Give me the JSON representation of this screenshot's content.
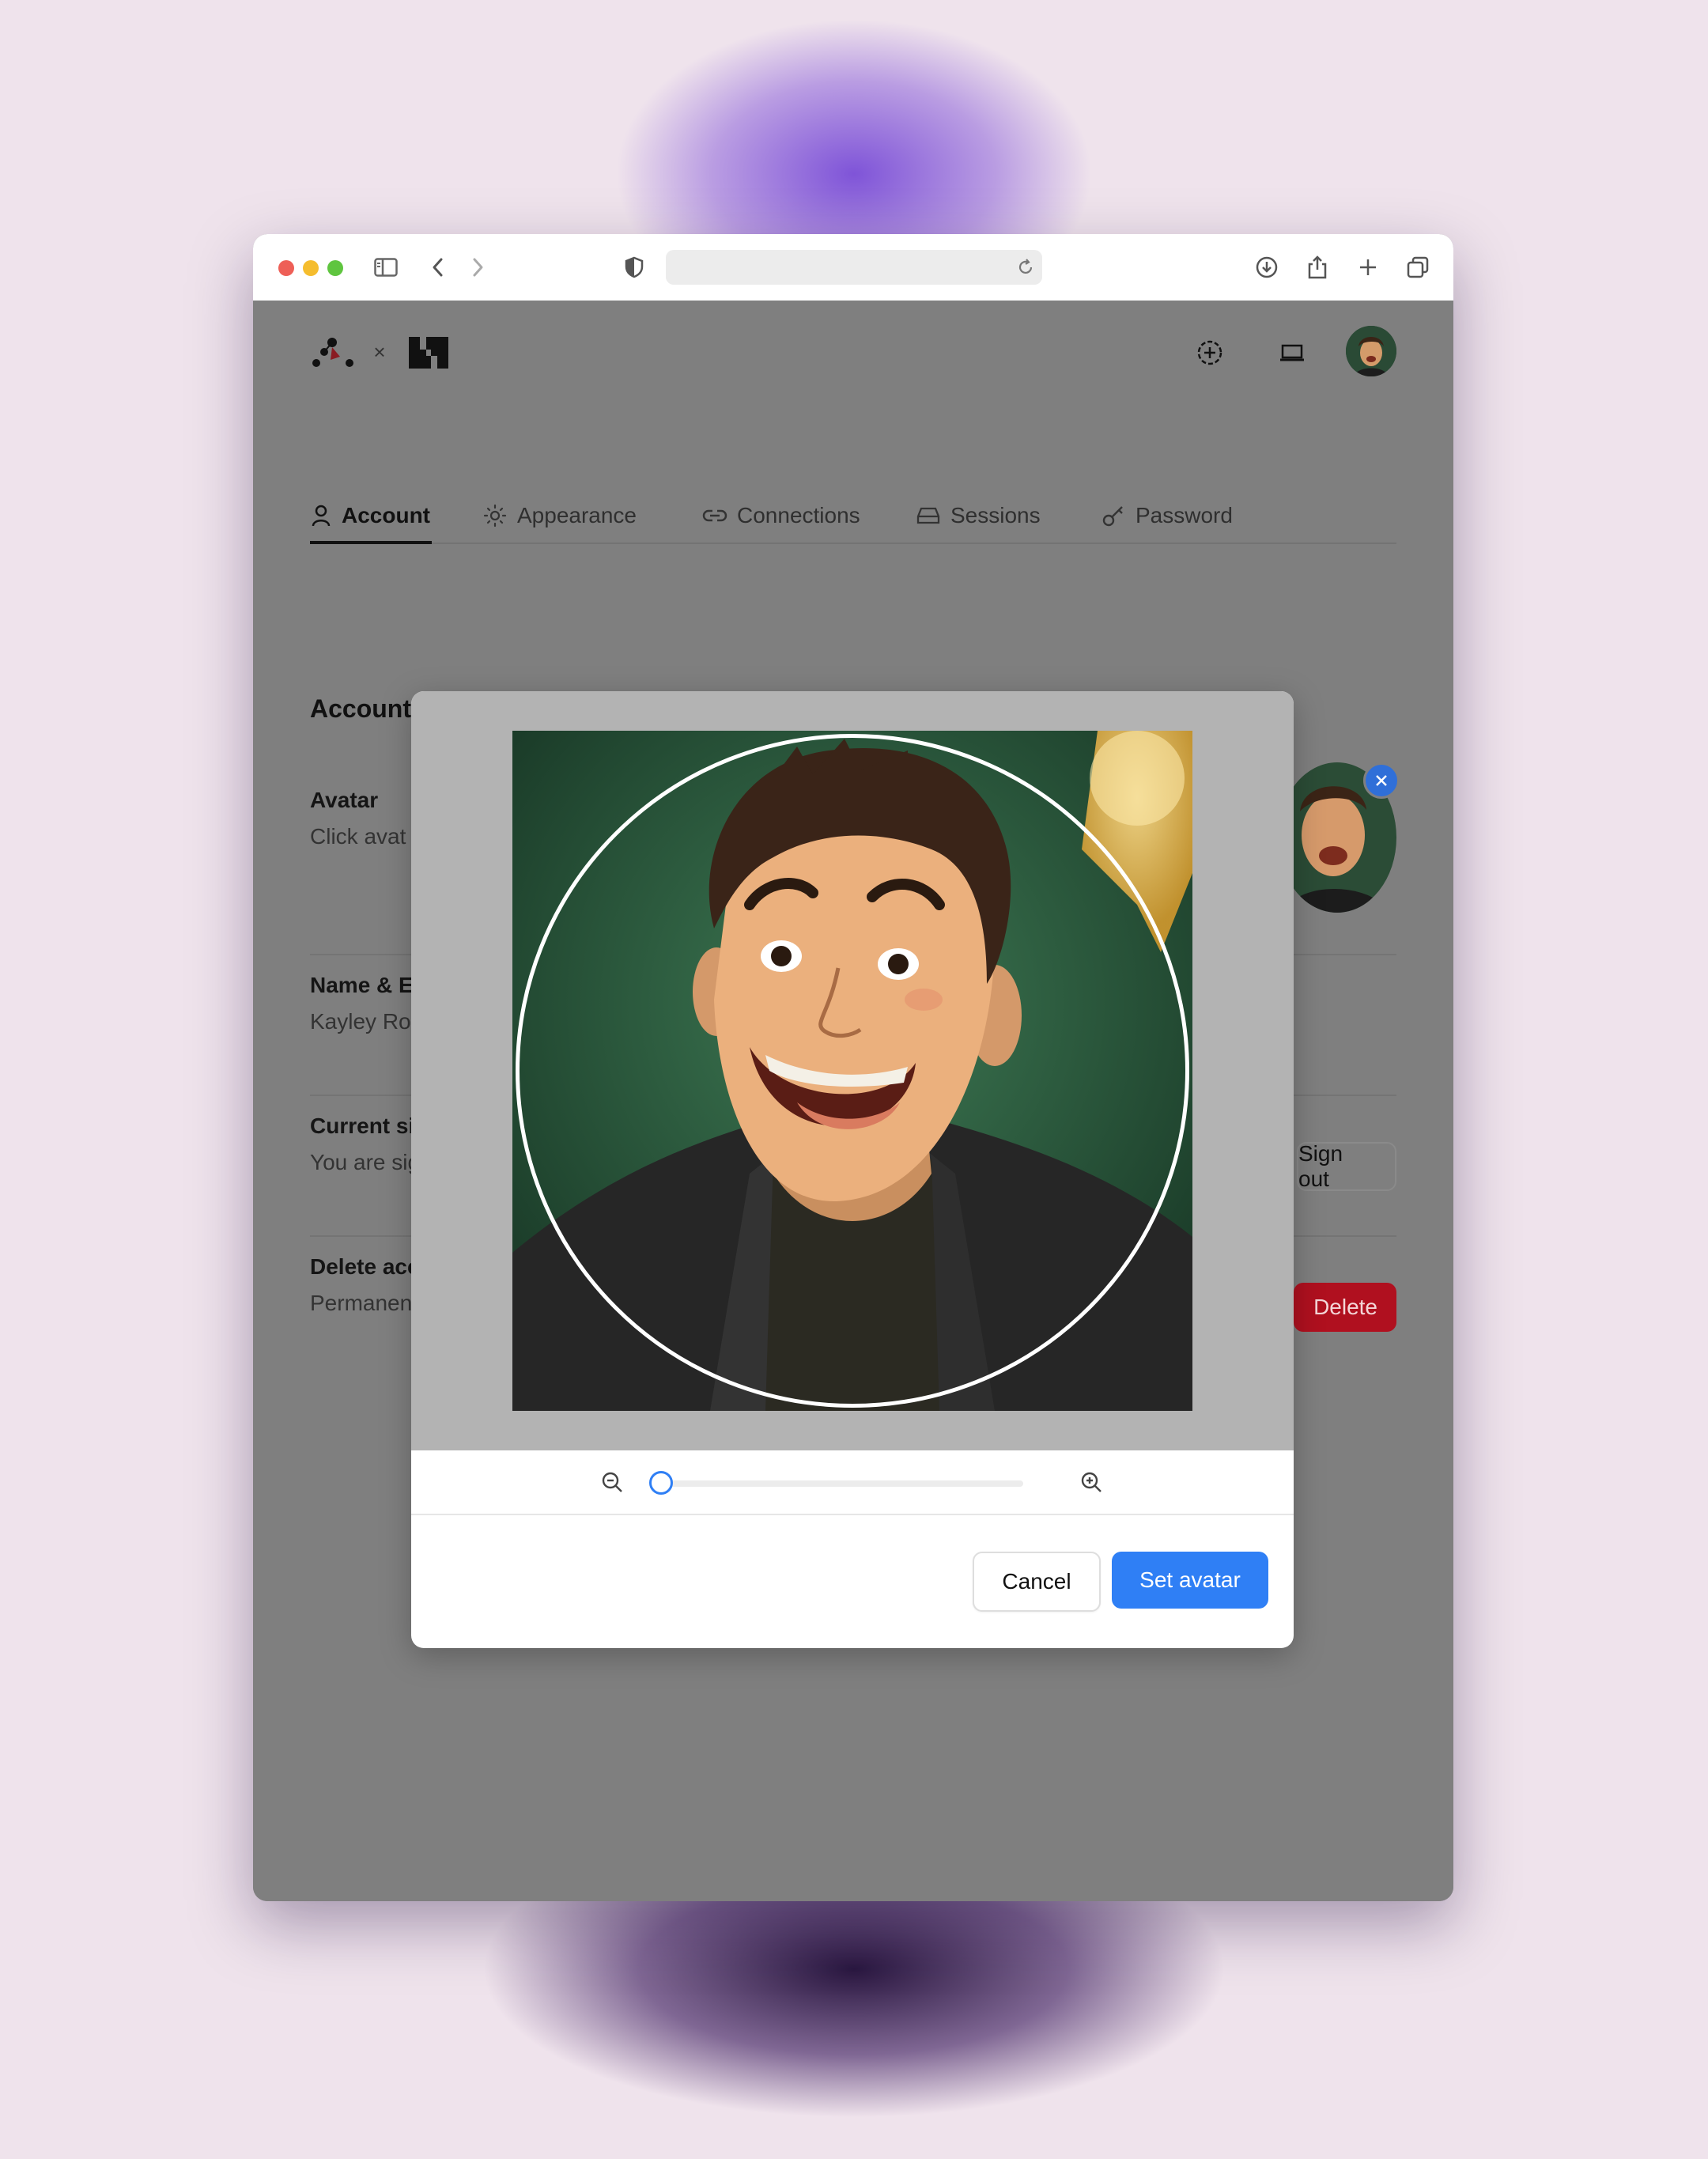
{
  "tabs": [
    {
      "label": "Account",
      "icon": "user-icon",
      "active": true
    },
    {
      "label": "Appearance",
      "icon": "sun-icon",
      "active": false
    },
    {
      "label": "Connections",
      "icon": "link-icon",
      "active": false
    },
    {
      "label": "Sessions",
      "icon": "drive-icon",
      "active": false
    },
    {
      "label": "Password",
      "icon": "key-icon",
      "active": false
    }
  ],
  "header": {
    "separator": "×"
  },
  "account": {
    "section_title": "Account",
    "rows": [
      {
        "title": "Avatar",
        "subtitle": "Click avat"
      },
      {
        "title": "Name & E",
        "subtitle": "Kayley Ro"
      },
      {
        "title": "Current si",
        "subtitle": "You are sig"
      },
      {
        "title": "Delete acc",
        "subtitle": "Permanen"
      }
    ],
    "signout_label": "Sign out",
    "delete_label": "Delete"
  },
  "crop_dialog": {
    "zoom_level": 0,
    "cancel_label": "Cancel",
    "confirm_label": "Set avatar"
  },
  "colors": {
    "accent": "#2f7ff5",
    "danger": "#b0101f",
    "overlay": "#7f7f7f"
  }
}
